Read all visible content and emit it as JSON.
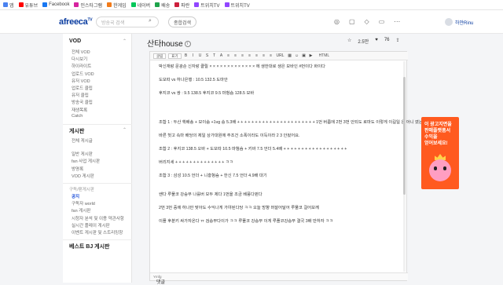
{
  "bookmarks": [
    {
      "label": "앱",
      "color": "#4a82f0"
    },
    {
      "label": "유튜브",
      "color": "#ff0000"
    },
    {
      "label": "Facebook",
      "color": "#1877f2"
    },
    {
      "label": "인스타그램",
      "color": "#d6249f"
    },
    {
      "label": "한게임",
      "color": "#f27b1a"
    },
    {
      "label": "네이버",
      "color": "#03c75a"
    },
    {
      "label": "배송",
      "color": "#1ea34a"
    },
    {
      "label": "파란",
      "color": "#cc1f3c"
    },
    {
      "label": "트위치TV",
      "color": "#9146ff"
    },
    {
      "label": "트위치TV",
      "color": "#9146ff"
    }
  ],
  "header": {
    "logo": "afreeca",
    "logo_sup": "TV",
    "search_placeholder": "방송국 검색",
    "top_button": "종합검색",
    "user_name": "하얀Rinu"
  },
  "sidebar": {
    "sections": [
      {
        "title": "VOD",
        "items": [
          "전체 VOD",
          "다시보기",
          "하이라이트",
          "업로드 VOD",
          "유저 VOD",
          "업로드 클립",
          "유저 클립",
          "방송국 클립",
          "재생목록",
          "Catch"
        ]
      },
      {
        "title": "게시판",
        "items": [
          "전체 게시글"
        ]
      },
      {
        "title": "",
        "items": [
          "일반 게시판",
          "fan 사업 게시판",
          "방명록",
          "VOD 게시판"
        ]
      },
      {
        "title": "구독/팬게시판",
        "items": [
          "공지",
          "구독자 world",
          "fan 게시판",
          "시청자 분석 및 이용 약관사항",
          "실시간 플레이 게시판",
          "이벤트 게시판 및 스트리밍창"
        ]
      },
      {
        "title": "베스트 BJ 게시판",
        "items": []
      }
    ],
    "active_item": "공지"
  },
  "main": {
    "title": "산타house",
    "info_icon": "i",
    "stats": {
      "views": "2.5만",
      "likes": "76"
    }
  },
  "editor": {
    "toolbar": {
      "font_select": "굴림",
      "size_select": "표기",
      "buttons": [
        "B",
        "I",
        "U",
        "S",
        "T",
        "A",
        "≡",
        "≡",
        "≡",
        "≡",
        "≡",
        "≡",
        "≡",
        "URL",
        "▦",
        "☺",
        "▣",
        "▶"
      ],
      "html_label": "HTML"
    },
    "content_lines": [
      "박신재랑 문광순 신자랑 클릴 × × × × × × × × × × × × × 에 생한대로 생은 모바인 #번이다 화이다",
      "도모따 vs 하나은행 : 10.5 132.5 도마안",
      "후지코 vs 쌍 : 9.5 138.5 후지코 9.5 마헝슴 128.5 모바",
      "조합 1 : 두산 핵배송 + 모이슴 +1vg 승 5.3배 + + + + + + + + + + + + + + + + + + + + + + 1번 버릅에 2번 3번 안되도 로마도 이렇게 이길일 은 아니 였는데",
      "바른 헛고 속마 배당의 제일 상가대원에 주조건 소폭이라도 이득이라 2 3 안됬어요.",
      "조합 2 : 후지코 138.5 오바 + 도모따 10.5 마헝슴 + 키바 7.5 언더 5.4배 + + + + + + + + + + + + + + + + + +",
      "버리지세 + + + + + + + + + + + + + + ㅋㅋ",
      "조합 3 : 삼성 10.5 언더 + 니홍헝슴 + 한신 7.5 언더 4.9배 대기",
      "쌘다 루풀코 강승부 나를버 모두 제다 1번을 조금 베풍다뛴다",
      "2번 3번 중에 하나만 맞아도 수익나게 가야된다당 ㅋㅋ 오늘 방향 머잘어달어 루풀코 걸어보께",
      "이플 후분키 싸가자온다 ㅠ 검승부다이가 ㅋㅋ 루풀코 강승부 이게 루플코강승부 결국 3배 만하자 ㅋㅋ"
    ],
    "status_label": "Ymfg"
  },
  "ad": {
    "lines": [
      "이 광고지면을",
      "판매플랫폼서",
      "수익을",
      "얻어보세요!"
    ],
    "colors": {
      "background": "#ff5a1f",
      "text": "#ffffff"
    }
  },
  "footer_cut": "댓글"
}
